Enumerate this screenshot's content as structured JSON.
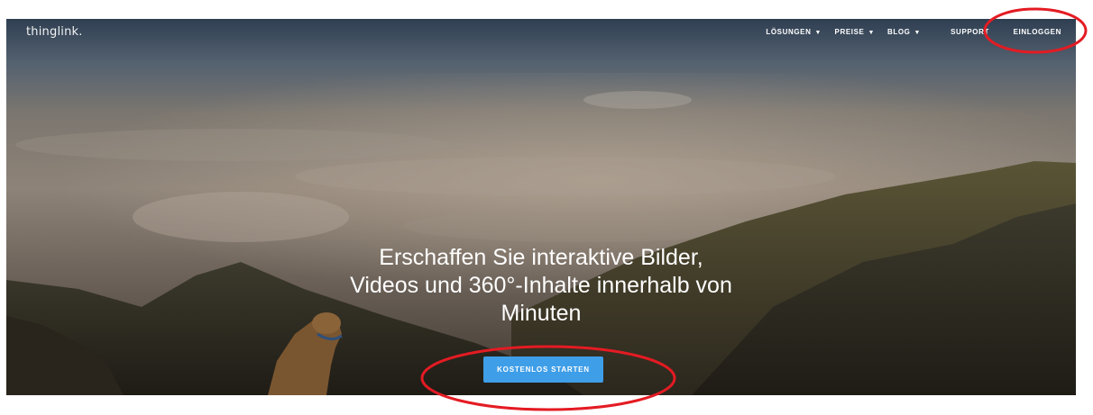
{
  "brand": {
    "logo_text": "thinglink."
  },
  "nav": {
    "items": [
      {
        "label": "LÖSUNGEN",
        "icon": "chevron-down-icon"
      },
      {
        "label": "PREISE",
        "icon": "chevron-down-icon"
      },
      {
        "label": "BLOG",
        "icon": "chevron-down-icon"
      },
      {
        "label": "SUPPORT"
      },
      {
        "label": "EINLOGGEN"
      }
    ]
  },
  "hero": {
    "headline_line1": "Erschaffen Sie interaktive Bilder,",
    "headline_line2": "Videos und 360°-Inhalte innerhalb von",
    "headline_line3": "Minuten",
    "cta_label": "KOSTENLOS STARTEN"
  },
  "colors": {
    "cta": "#3f9ee8",
    "annotation": "#e41b23",
    "text": "#ffffff"
  }
}
